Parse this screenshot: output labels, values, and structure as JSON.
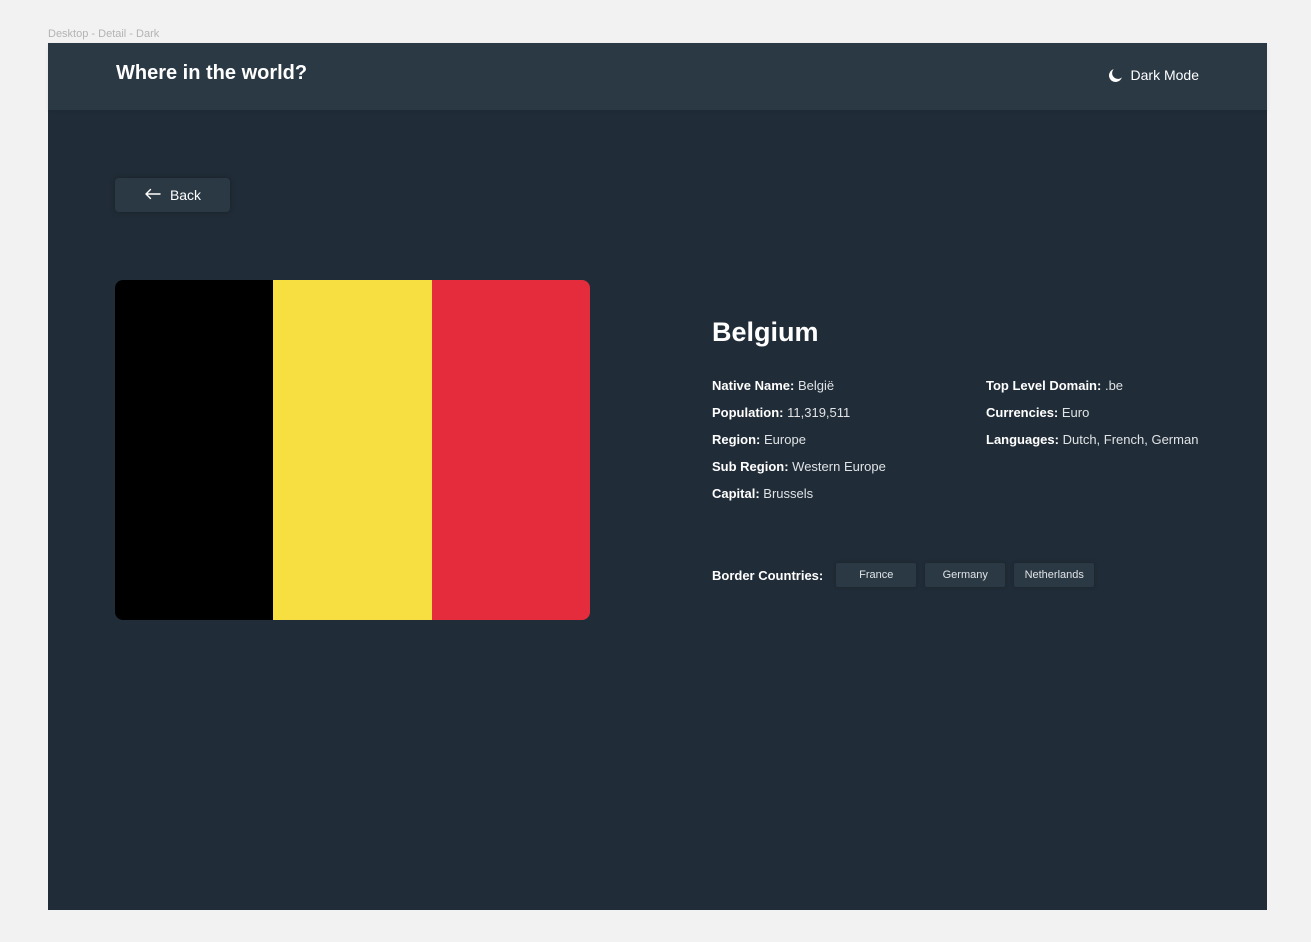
{
  "frame_label": "Desktop - Detail - Dark",
  "header": {
    "title": "Where in the world?",
    "theme_toggle": {
      "label": "Dark Mode",
      "icon": "moon-icon"
    }
  },
  "back_button": {
    "label": "Back",
    "icon": "arrow-left-icon"
  },
  "flag": {
    "colors": [
      "#000000",
      "#f7df42",
      "#e52c3c"
    ]
  },
  "country": {
    "name": "Belgium",
    "left_details": [
      {
        "label": "Native Name:",
        "value": "België"
      },
      {
        "label": "Population:",
        "value": "11,319,511"
      },
      {
        "label": "Region:",
        "value": "Europe"
      },
      {
        "label": "Sub Region:",
        "value": "Western Europe"
      },
      {
        "label": "Capital:",
        "value": "Brussels"
      }
    ],
    "right_details": [
      {
        "label": "Top Level Domain:",
        "value": ".be"
      },
      {
        "label": "Currencies:",
        "value": "Euro"
      },
      {
        "label": "Languages:",
        "value": "Dutch, French, German"
      }
    ],
    "border_countries_label": "Border Countries:",
    "border_countries": [
      "France",
      "Germany",
      "Netherlands"
    ]
  },
  "colors": {
    "background": "#202c37",
    "element": "#2b3945",
    "text": "#ffffff"
  }
}
